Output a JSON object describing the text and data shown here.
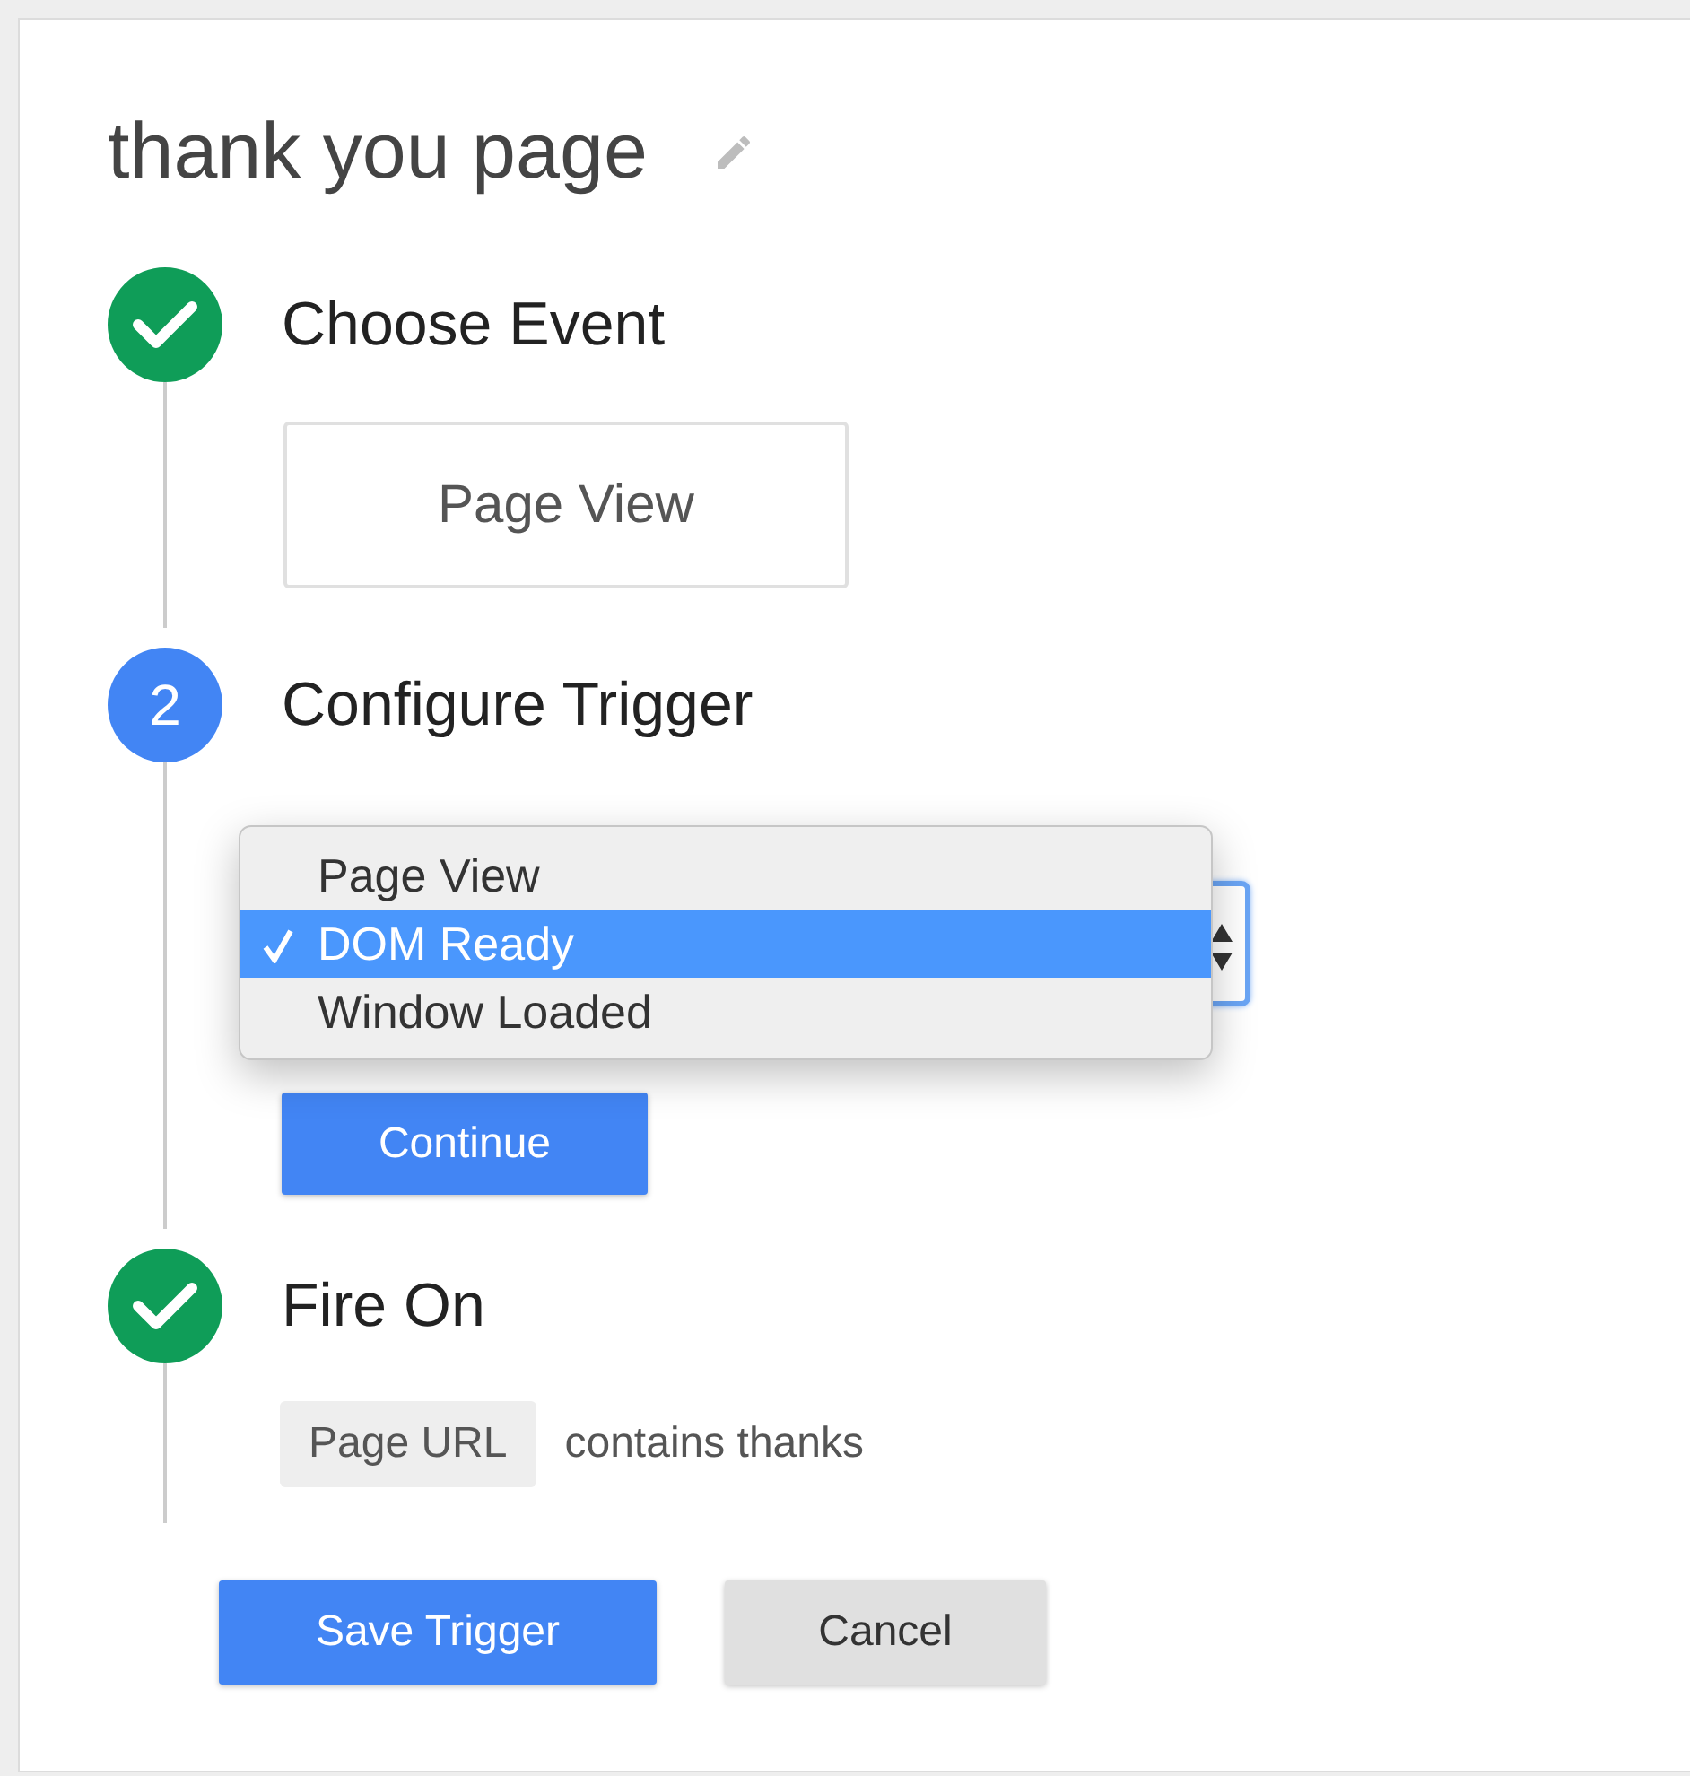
{
  "title": "thank you page",
  "steps": [
    {
      "kind": "done",
      "label": "Choose Event",
      "event": "Page View"
    },
    {
      "kind": "active",
      "number": "2",
      "label": "Configure Trigger",
      "options": [
        {
          "label": "Page View",
          "selected": false
        },
        {
          "label": "DOM Ready",
          "selected": true
        },
        {
          "label": "Window Loaded",
          "selected": false
        }
      ],
      "button": "Continue"
    },
    {
      "kind": "done",
      "label": "Fire On",
      "filter": {
        "variable": "Page URL",
        "condition": "contains thanks"
      }
    }
  ],
  "buttons": [
    {
      "kind": "primary",
      "label": "Save Trigger"
    },
    {
      "kind": "secondary",
      "label": "Cancel"
    }
  ]
}
